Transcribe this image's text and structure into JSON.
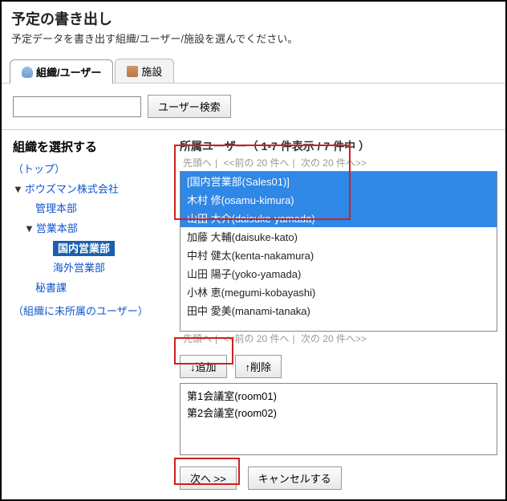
{
  "header": {
    "title": "予定の書き出し",
    "subtitle": "予定データを書き出す組織/ユーザー/施設を選んでください。"
  },
  "tabs": {
    "org_user": "組織/ユーザー",
    "facility": "施設"
  },
  "search": {
    "button": "ユーザー検索"
  },
  "left": {
    "title": "組織を選択する",
    "top": "（トップ）",
    "company": "ボウズマン株式会社",
    "dept_admin": "管理本部",
    "dept_sales": "営業本部",
    "dept_sales_dom": "国内営業部",
    "dept_sales_int": "海外営業部",
    "dept_sec": "秘書課",
    "unassigned": "（組織に未所属のユーザー）"
  },
  "right": {
    "title": "所属ユーザー（ 1-7 件表示 / 7 件中 ）",
    "pager_top": "先頭へ",
    "pager_prev": "<<前の 20 件へ",
    "pager_next": "次の 20 件へ>>",
    "users": [
      "[国内営業部(Sales01)]",
      "木村 修(osamu-kimura)",
      "山田 大介(daisuke-yamada)",
      "加藤 大輔(daisuke-kato)",
      "中村 健太(kenta-nakamura)",
      "山田 陽子(yoko-yamada)",
      "小林 恵(megumi-kobayashi)",
      "田中 愛美(manami-tanaka)"
    ],
    "btn_add": "↓追加",
    "btn_del": "↑削除",
    "selected": [
      "第1会議室(room01)",
      "第2会議室(room02)"
    ],
    "btn_next": "次へ >>",
    "btn_cancel": "キャンセルする"
  }
}
